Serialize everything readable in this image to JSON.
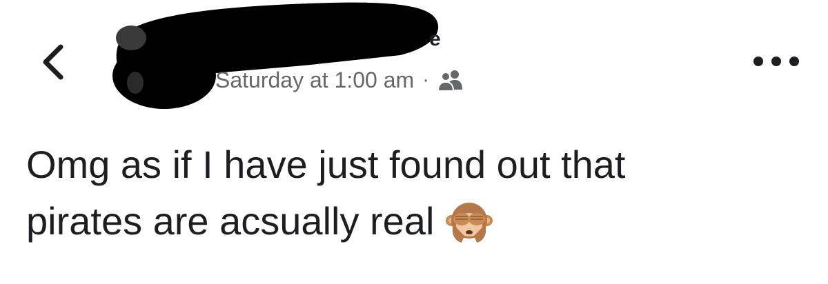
{
  "header": {
    "name_visible_fragment": "e",
    "timestamp": "Saturday at 1:00 am",
    "separator": "·",
    "audience_icon": "friends-icon"
  },
  "post": {
    "line1": "Omg as if I have just found out that",
    "line2": "pirates are acsually real",
    "emoji": "see-no-evil-monkey-icon"
  },
  "icons": {
    "back": "chevron-left-icon",
    "more": "more-options-icon"
  },
  "colors": {
    "text": "#1c1e21",
    "secondary_text": "#65676b",
    "redaction": "#000000",
    "background": "#ffffff"
  }
}
